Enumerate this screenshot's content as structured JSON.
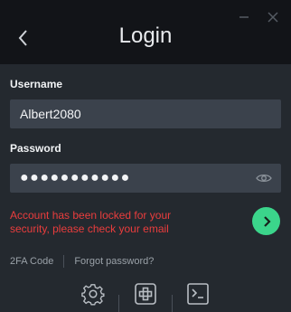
{
  "header": {
    "title": "Login"
  },
  "form": {
    "username_label": "Username",
    "username_value": "Albert2080",
    "password_label": "Password",
    "password_mask": "●●●●●●●●●●●"
  },
  "error": {
    "message": "Account has been locked for your security, please check your email"
  },
  "links": {
    "twofa": "2FA Code",
    "forgot": "Forgot password?"
  },
  "colors": {
    "background": "#24292f",
    "header": "#121418",
    "field": "#3b424c",
    "accent": "#3bd58b",
    "error": "#ea3d3d"
  },
  "icons": {
    "back": "chevron-left-icon",
    "minimize": "minimize-icon",
    "close": "close-icon",
    "eye": "eye-icon",
    "submit": "chevron-right-icon",
    "settings": "gear-icon",
    "add": "plus-icon",
    "terminal": "terminal-icon"
  }
}
